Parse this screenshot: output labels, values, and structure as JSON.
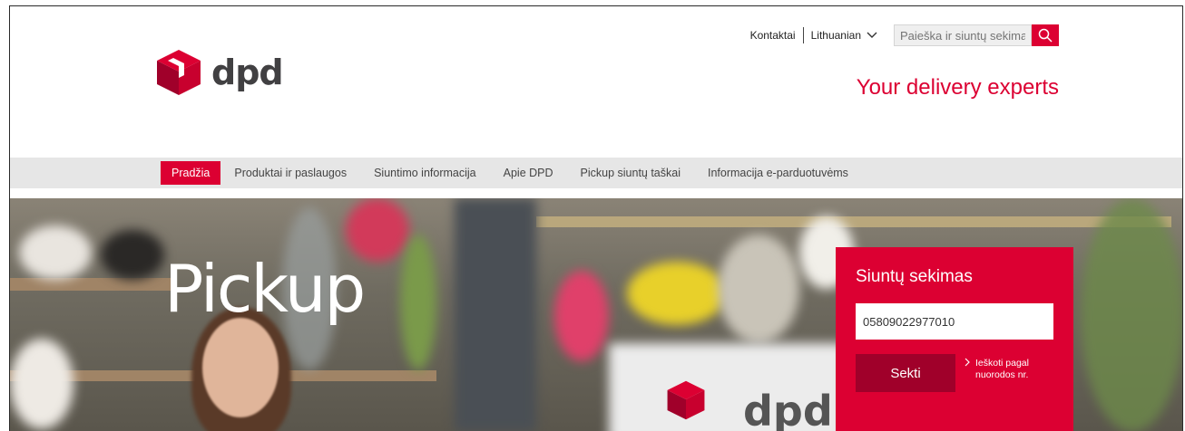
{
  "header": {
    "logo_text": "dpd",
    "tagline": "Your delivery experts",
    "links": {
      "contacts": "Kontaktai",
      "language": "Lithuanian"
    },
    "search": {
      "placeholder": "Paieška ir siuntų sekimas",
      "value": ""
    }
  },
  "nav": {
    "items": [
      {
        "label": "Pradžia",
        "active": true
      },
      {
        "label": "Produktai ir paslaugos"
      },
      {
        "label": "Siuntimo informacija"
      },
      {
        "label": "Apie DPD"
      },
      {
        "label": "Pickup siuntų taškai"
      },
      {
        "label": "Informacija e-parduotuvėms"
      }
    ]
  },
  "hero": {
    "title": "Pickup",
    "background_text": "dpd",
    "tracking": {
      "title": "Siuntų sekimas",
      "input_value": "05809022977010",
      "button_label": "Sekti",
      "link_label": "Ieškoti pagal nuorodos nr."
    }
  },
  "colors": {
    "accent": "#dc0032",
    "dark_accent": "#a0002a",
    "nav_bg": "#e6e6e6"
  },
  "icons": [
    "dpd-logo-icon",
    "chevron-down-icon",
    "search-icon",
    "chevron-right-icon"
  ]
}
